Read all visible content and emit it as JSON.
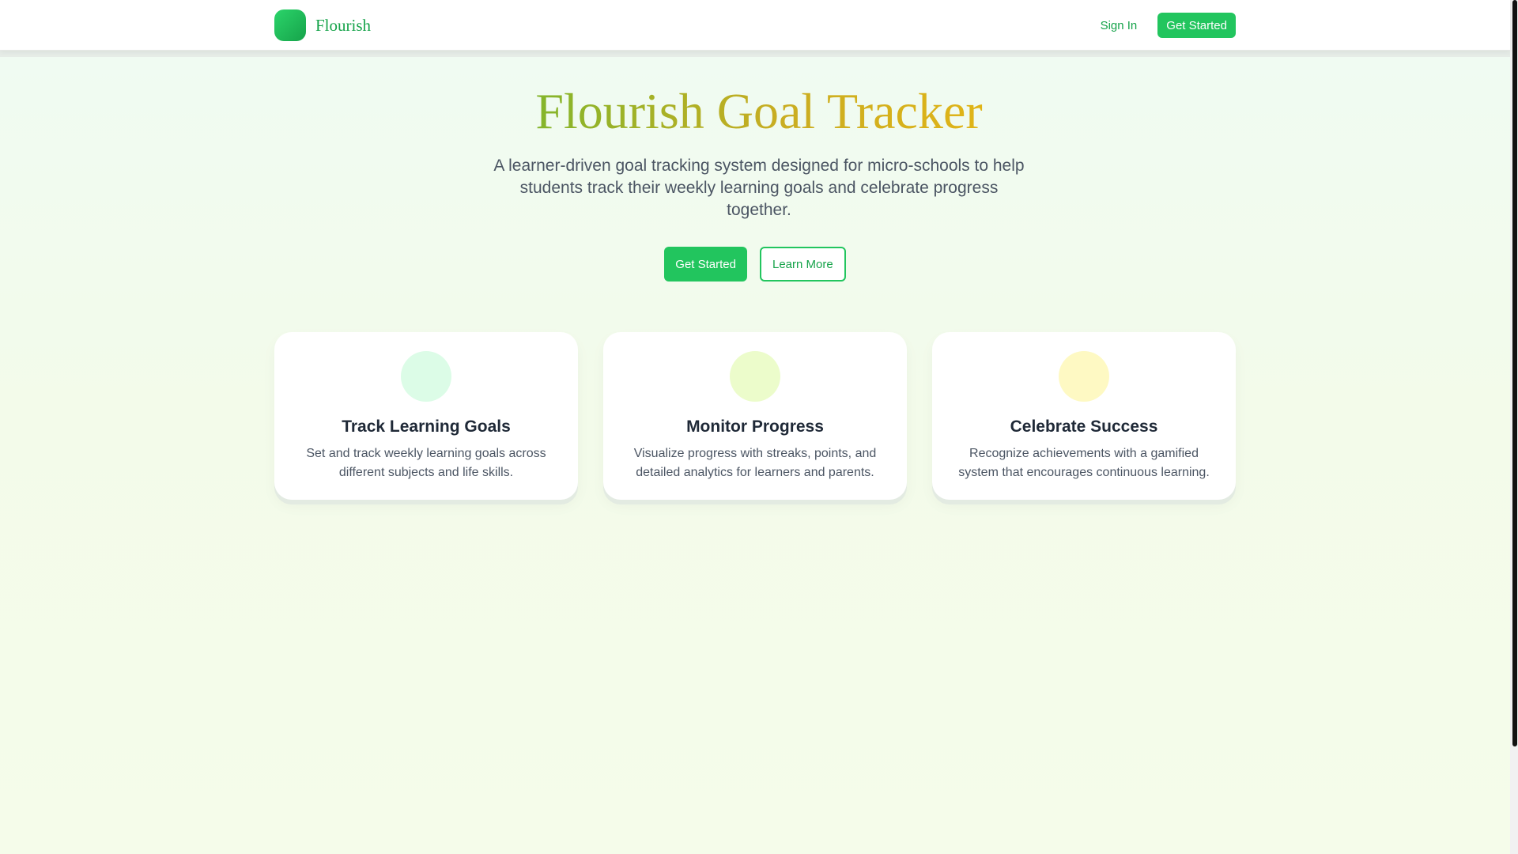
{
  "header": {
    "brand_name": "Flourish",
    "sign_in_label": "Sign In",
    "get_started_label": "Get Started"
  },
  "hero": {
    "title": "Flourish Goal Tracker",
    "subtitle": "A learner-driven goal tracking system designed for micro-schools to help students track their weekly learning goals and celebrate progress together.",
    "primary_cta": "Get Started",
    "secondary_cta": "Learn More"
  },
  "features": [
    {
      "title": "Track Learning Goals",
      "description": "Set and track weekly learning goals across different subjects and life skills.",
      "icon_color": "#dcfce7"
    },
    {
      "title": "Monitor Progress",
      "description": "Visualize progress with streaks, points, and detailed analytics for learners and parents.",
      "icon_color": "#ecfccb"
    },
    {
      "title": "Celebrate Success",
      "description": "Recognize achievements with a gamified system that encourages continuous learning.",
      "icon_color": "#fef9c3"
    }
  ],
  "colors": {
    "accent": "#22c55e",
    "accent_dark": "#16a34a",
    "title_gradient_start": "#84b52b",
    "title_gradient_end": "#e0b417"
  }
}
